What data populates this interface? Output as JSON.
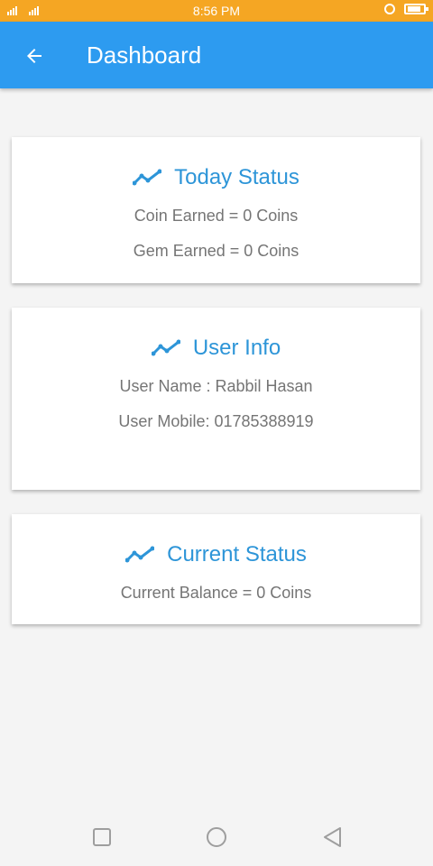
{
  "status_bar": {
    "signal_text": "₎ᴴʟᴵ ₎ᴴʟᴵ",
    "time": "8:56 PM"
  },
  "app_bar": {
    "title": "Dashboard",
    "back_icon": "arrow-back-icon",
    "color": "#2d9bf0"
  },
  "cards": [
    {
      "icon": "trending-line-icon",
      "title": "Today Status",
      "lines": [
        "Coin Earned = 0 Coins",
        "Gem Earned = 0 Coins"
      ]
    },
    {
      "icon": "trending-line-icon",
      "title": "User Info",
      "lines": [
        "User Name : Rabbil Hasan",
        "User Mobile: 01785388919"
      ]
    },
    {
      "icon": "trending-line-icon",
      "title": "Current Status",
      "lines": [
        "Current Balance = 0 Coins"
      ]
    }
  ],
  "nav_bar": {
    "recents_icon": "square-icon",
    "home_icon": "circle-icon",
    "back_icon": "triangle-back-icon"
  },
  "colors": {
    "status_bar": "#f5a623",
    "accent": "#2d95d8",
    "text_secondary": "#757575"
  }
}
